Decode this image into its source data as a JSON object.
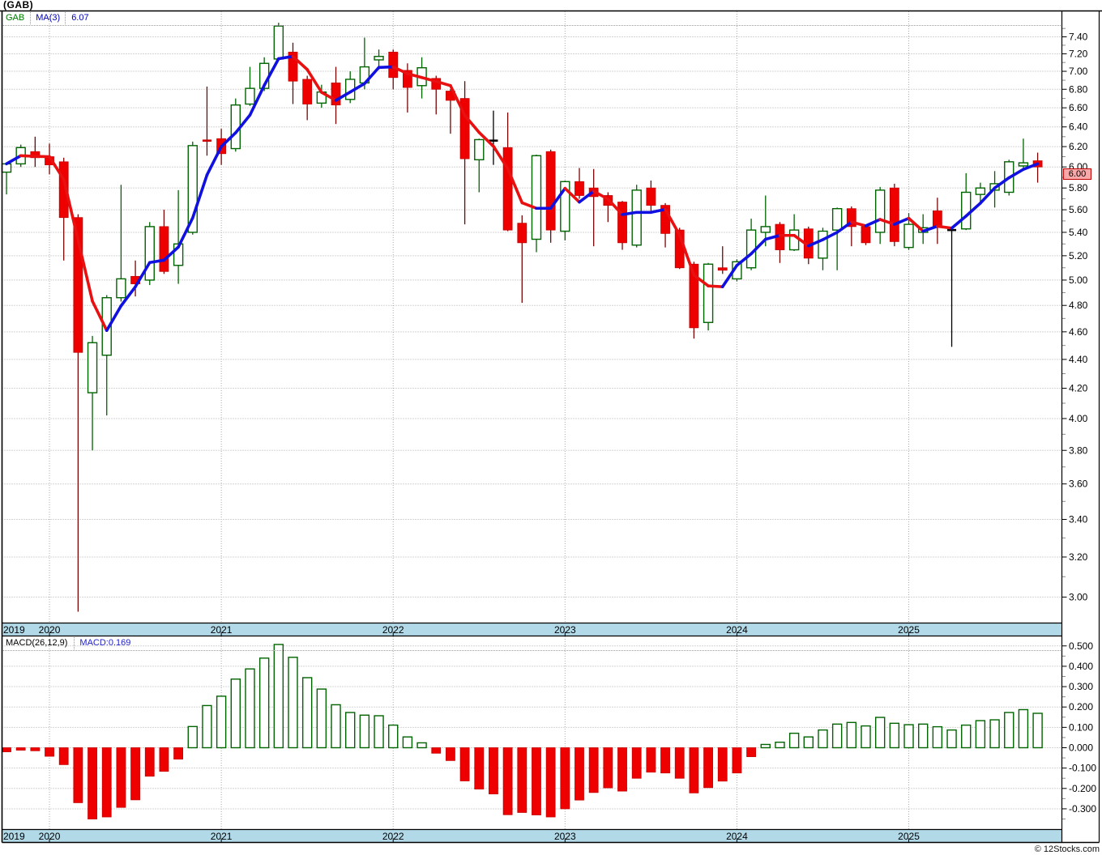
{
  "title": "(GAB)",
  "legend": {
    "symbol": "GAB",
    "ma_label": "MA(3)",
    "ma_value": "6.07"
  },
  "macd_legend": {
    "label": "MACD(26,12,9)",
    "value_label": "MACD:0.169"
  },
  "price_box": "6.00",
  "copyright": "© 12Stocks.com",
  "colors": {
    "up": "#006400",
    "up_wick": "#006400",
    "down": "#EE0000",
    "down_border": "#C80000",
    "down_wick": "#7A0505",
    "neutral": "#000000",
    "ma_up": "#1010E0",
    "ma_down": "#E81010",
    "grid": "#ABABAB",
    "minor_tick": "#8C8C8C",
    "band": "#B2D9E8",
    "badge_bg": "#F7A8A8",
    "badge_border": "#C00000",
    "frame": "#000000"
  },
  "chart_data": [
    {
      "type": "candlestick",
      "title": "GAB monthly candlesticks with MA(3)",
      "date_start": "2019-10",
      "date_end": "2025-10",
      "ma_period": 3,
      "ylim": [
        2.9,
        7.6
      ],
      "grid": true,
      "scale": "log",
      "price_ticks": [
        "7.40",
        "7.20",
        "7.00",
        "6.80",
        "6.60",
        "6.40",
        "6.20",
        "6.00",
        "5.80",
        "5.60",
        "5.40",
        "5.20",
        "5.00",
        "4.80",
        "4.60",
        "4.40",
        "4.20",
        "4.00",
        "3.80",
        "3.60",
        "3.40",
        "3.20",
        "3.00"
      ],
      "left_edge_year_label": "2019",
      "grid_years": [
        {
          "label": "2020",
          "month_index": 3
        },
        {
          "label": "2021",
          "month_index": 15
        },
        {
          "label": "2022",
          "month_index": 27
        },
        {
          "label": "2023",
          "month_index": 39
        },
        {
          "label": "2024",
          "month_index": 51
        },
        {
          "label": "2025",
          "month_index": 63
        }
      ],
      "months": [
        "2019-10",
        "2019-11",
        "2019-12",
        "2020-01",
        "2020-02",
        "2020-03",
        "2020-04",
        "2020-05",
        "2020-06",
        "2020-07",
        "2020-08",
        "2020-09",
        "2020-10",
        "2020-11",
        "2020-12",
        "2021-01",
        "2021-02",
        "2021-03",
        "2021-04",
        "2021-05",
        "2021-06",
        "2021-07",
        "2021-08",
        "2021-09",
        "2021-10",
        "2021-11",
        "2021-12",
        "2022-01",
        "2022-02",
        "2022-03",
        "2022-04",
        "2022-05",
        "2022-06",
        "2022-07",
        "2022-08",
        "2022-09",
        "2022-10",
        "2022-11",
        "2022-12",
        "2023-01",
        "2023-02",
        "2023-03",
        "2023-04",
        "2023-05",
        "2023-06",
        "2023-07",
        "2023-08",
        "2023-09",
        "2023-10",
        "2023-11",
        "2023-12",
        "2024-01",
        "2024-02",
        "2024-03",
        "2024-04",
        "2024-05",
        "2024-06",
        "2024-07",
        "2024-08",
        "2024-09",
        "2024-10",
        "2024-11",
        "2024-12",
        "2025-01",
        "2025-02",
        "2025-03",
        "2025-04",
        "2025-05",
        "2025-06",
        "2025-07",
        "2025-08",
        "2025-09",
        "2025-10"
      ],
      "ohlc": [
        [
          5.95,
          6.04,
          5.74,
          6.03
        ],
        [
          6.03,
          6.22,
          6.0,
          6.19
        ],
        [
          6.15,
          6.3,
          6.0,
          6.09
        ],
        [
          6.1,
          6.23,
          5.93,
          6.02
        ],
        [
          6.05,
          6.09,
          5.16,
          5.53
        ],
        [
          5.53,
          5.56,
          2.93,
          4.45
        ],
        [
          4.17,
          4.57,
          3.8,
          4.52
        ],
        [
          4.43,
          4.88,
          4.02,
          4.86
        ],
        [
          4.86,
          5.83,
          4.83,
          5.01
        ],
        [
          5.03,
          5.16,
          4.87,
          4.97
        ],
        [
          5.0,
          5.49,
          4.96,
          5.45
        ],
        [
          5.45,
          5.6,
          5.05,
          5.07
        ],
        [
          5.12,
          5.78,
          4.97,
          5.3
        ],
        [
          5.4,
          6.25,
          5.38,
          6.21
        ],
        [
          6.26,
          6.83,
          6.11,
          6.26
        ],
        [
          6.28,
          6.38,
          6.02,
          6.13
        ],
        [
          6.18,
          6.7,
          6.15,
          6.63
        ],
        [
          6.64,
          7.05,
          6.62,
          6.81
        ],
        [
          6.81,
          7.16,
          6.78,
          7.09
        ],
        [
          7.14,
          7.57,
          7.12,
          7.53
        ],
        [
          7.22,
          7.33,
          6.64,
          6.89
        ],
        [
          6.91,
          6.95,
          6.47,
          6.64
        ],
        [
          6.65,
          6.85,
          6.6,
          6.77
        ],
        [
          6.87,
          7.05,
          6.43,
          6.63
        ],
        [
          6.69,
          7.0,
          6.65,
          6.91
        ],
        [
          6.87,
          7.39,
          6.8,
          7.05
        ],
        [
          7.13,
          7.25,
          7.02,
          7.17
        ],
        [
          7.22,
          7.25,
          6.8,
          6.93
        ],
        [
          7.01,
          7.09,
          6.55,
          6.82
        ],
        [
          6.84,
          7.16,
          6.7,
          7.04
        ],
        [
          6.92,
          6.95,
          6.53,
          6.8
        ],
        [
          6.78,
          6.8,
          6.33,
          6.68
        ],
        [
          6.7,
          6.89,
          5.47,
          6.08
        ],
        [
          6.07,
          6.28,
          5.76,
          6.27
        ],
        [
          6.26,
          6.57,
          6.02,
          6.26
        ],
        [
          6.19,
          6.55,
          5.41,
          5.42
        ],
        [
          5.48,
          5.55,
          4.82,
          5.31
        ],
        [
          5.34,
          6.12,
          5.23,
          6.11
        ],
        [
          6.15,
          6.17,
          5.31,
          5.42
        ],
        [
          5.41,
          5.87,
          5.33,
          5.86
        ],
        [
          5.86,
          5.99,
          5.7,
          5.73
        ],
        [
          5.8,
          5.98,
          5.28,
          5.72
        ],
        [
          5.73,
          5.76,
          5.49,
          5.64
        ],
        [
          5.67,
          5.68,
          5.25,
          5.31
        ],
        [
          5.29,
          5.83,
          5.27,
          5.78
        ],
        [
          5.8,
          5.87,
          5.58,
          5.64
        ],
        [
          5.64,
          5.66,
          5.27,
          5.39
        ],
        [
          5.42,
          5.44,
          5.09,
          5.1
        ],
        [
          5.13,
          5.15,
          4.55,
          4.63
        ],
        [
          4.67,
          5.14,
          4.61,
          5.13
        ],
        [
          5.1,
          5.28,
          5.05,
          5.08
        ],
        [
          5.01,
          5.17,
          4.99,
          5.15
        ],
        [
          5.1,
          5.52,
          5.08,
          5.42
        ],
        [
          5.4,
          5.73,
          5.28,
          5.45
        ],
        [
          5.47,
          5.49,
          5.14,
          5.25
        ],
        [
          5.25,
          5.56,
          5.24,
          5.42
        ],
        [
          5.43,
          5.45,
          5.13,
          5.18
        ],
        [
          5.18,
          5.44,
          5.08,
          5.41
        ],
        [
          5.42,
          5.62,
          5.08,
          5.61
        ],
        [
          5.61,
          5.63,
          5.28,
          5.45
        ],
        [
          5.45,
          5.47,
          5.29,
          5.31
        ],
        [
          5.4,
          5.81,
          5.3,
          5.78
        ],
        [
          5.8,
          5.84,
          5.28,
          5.32
        ],
        [
          5.27,
          5.57,
          5.25,
          5.47
        ],
        [
          5.4,
          5.56,
          5.3,
          5.44
        ],
        [
          5.59,
          5.71,
          5.3,
          5.45
        ],
        [
          5.42,
          5.44,
          4.49,
          5.42
        ],
        [
          5.43,
          5.94,
          5.42,
          5.76
        ],
        [
          5.74,
          5.85,
          5.67,
          5.8
        ],
        [
          5.78,
          5.96,
          5.62,
          5.84
        ],
        [
          5.76,
          6.07,
          5.73,
          6.05
        ],
        [
          6.01,
          6.28,
          5.98,
          6.04
        ],
        [
          6.06,
          6.14,
          5.85,
          6.0
        ]
      ],
      "dir": [
        "u",
        "u",
        "d",
        "d",
        "d",
        "d",
        "u",
        "u",
        "u",
        "d",
        "u",
        "d",
        "u",
        "u",
        "d",
        "d",
        "u",
        "u",
        "u",
        "u",
        "d",
        "d",
        "u",
        "d",
        "u",
        "u",
        "u",
        "d",
        "d",
        "u",
        "d",
        "d",
        "d",
        "u",
        "n",
        "d",
        "d",
        "u",
        "d",
        "u",
        "d",
        "d",
        "d",
        "d",
        "u",
        "d",
        "d",
        "d",
        "d",
        "u",
        "d",
        "u",
        "u",
        "u",
        "d",
        "u",
        "d",
        "u",
        "u",
        "d",
        "d",
        "u",
        "d",
        "u",
        "u",
        "d",
        "n",
        "u",
        "u",
        "u",
        "u",
        "u",
        "d"
      ],
      "last_price": 6.0
    },
    {
      "type": "bar",
      "title": "MACD(26,12,9) histogram",
      "ylim": [
        -0.39,
        0.54
      ],
      "grid": true,
      "macd_ticks": [
        "0.500",
        "0.400",
        "0.300",
        "0.200",
        "0.100",
        "0.000",
        "-0.100",
        "-0.200",
        "-0.300"
      ],
      "values": [
        -0.02,
        -0.012,
        -0.015,
        -0.042,
        -0.083,
        -0.27,
        -0.35,
        -0.34,
        -0.293,
        -0.256,
        -0.14,
        -0.116,
        -0.056,
        0.104,
        0.207,
        0.253,
        0.337,
        0.387,
        0.44,
        0.507,
        0.444,
        0.344,
        0.288,
        0.211,
        0.173,
        0.16,
        0.157,
        0.111,
        0.053,
        0.024,
        -0.027,
        -0.063,
        -0.163,
        -0.203,
        -0.227,
        -0.329,
        -0.318,
        -0.33,
        -0.34,
        -0.3,
        -0.257,
        -0.22,
        -0.197,
        -0.213,
        -0.15,
        -0.12,
        -0.124,
        -0.15,
        -0.222,
        -0.196,
        -0.164,
        -0.124,
        -0.044,
        0.016,
        0.027,
        0.071,
        0.053,
        0.087,
        0.116,
        0.124,
        0.107,
        0.149,
        0.12,
        0.113,
        0.116,
        0.103,
        0.087,
        0.111,
        0.133,
        0.137,
        0.173,
        0.187,
        0.169
      ],
      "last_value": 0.169
    }
  ]
}
